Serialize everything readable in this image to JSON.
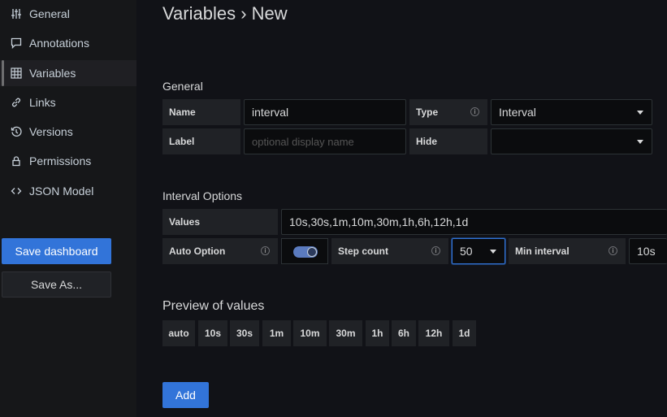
{
  "sidebar": {
    "items": [
      {
        "label": "General",
        "icon": "sliders-icon"
      },
      {
        "label": "Annotations",
        "icon": "comment-icon"
      },
      {
        "label": "Variables",
        "icon": "calculator-icon"
      },
      {
        "label": "Links",
        "icon": "link-icon"
      },
      {
        "label": "Versions",
        "icon": "history-icon"
      },
      {
        "label": "Permissions",
        "icon": "lock-icon"
      },
      {
        "label": "JSON Model",
        "icon": "code-icon"
      }
    ],
    "active": "Variables",
    "save_dashboard": "Save dashboard",
    "save_as": "Save As..."
  },
  "header": {
    "title": "Variables › New"
  },
  "general": {
    "title": "General",
    "name_label": "Name",
    "name_value": "interval",
    "type_label": "Type",
    "type_value": "Interval",
    "label_label": "Label",
    "label_placeholder": "optional display name",
    "hide_label": "Hide",
    "hide_value": ""
  },
  "interval_options": {
    "title": "Interval Options",
    "values_label": "Values",
    "values_value": "10s,30s,1m,10m,30m,1h,6h,12h,1d",
    "auto_option_label": "Auto Option",
    "auto_option_enabled": true,
    "step_count_label": "Step count",
    "step_count_value": "50",
    "min_interval_label": "Min interval",
    "min_interval_value": "10s"
  },
  "preview": {
    "title": "Preview of values",
    "values": [
      "auto",
      "10s",
      "30s",
      "1m",
      "10m",
      "30m",
      "1h",
      "6h",
      "12h",
      "1d"
    ]
  },
  "actions": {
    "add": "Add"
  },
  "colors": {
    "accent": "#3274d9",
    "background": "#111217",
    "sidebar": "#161719"
  }
}
